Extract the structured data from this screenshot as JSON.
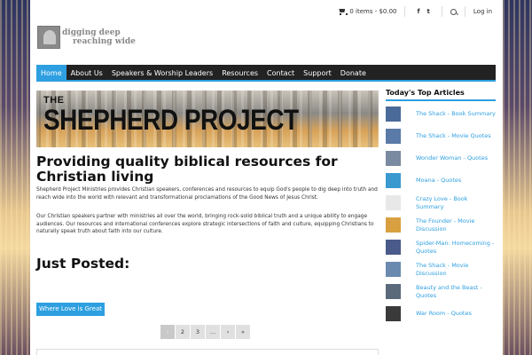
{
  "topbar": {
    "cart_text": "0 items - $0.00",
    "facebook": "f",
    "twitter": "t",
    "login": "Log in"
  },
  "logo": {
    "line1": "digging deep",
    "line2": "reaching wide"
  },
  "nav": {
    "items": [
      {
        "label": "Home",
        "active": true
      },
      {
        "label": "About Us"
      },
      {
        "label": "Speakers & Worship Leaders"
      },
      {
        "label": "Resources"
      },
      {
        "label": "Contact"
      },
      {
        "label": "Support"
      },
      {
        "label": "Donate"
      }
    ]
  },
  "hero": {
    "the": "THE",
    "title": "SHEPHERD PROJECT"
  },
  "main": {
    "headline": "Providing quality biblical resources for Christian living",
    "para1": "Shepherd Project Ministries provides Christian speakers, conferences and resources to equip God's people to dig deep into truth and reach wide into the world with relevant and transformational proclamations of the Good News of Jesus Christ.",
    "para2": "Our Christian speakers partner with ministries all over the world, bringing rock-solid biblical truth and a unique ability to engage audiences. Our resources and international conferences explore strategic intersections of faith and culture, equipping Christians to naturally speak truth about faith into our culture.",
    "just_posted": "Just Posted:",
    "post_button": "Where Love is Great",
    "pager": [
      "‹",
      "2",
      "3",
      "…",
      "›",
      "»"
    ]
  },
  "sidebar": {
    "title": "Today's Top Articles",
    "items": [
      {
        "label": "The Shack - Book Summary",
        "thumb": "#4a6a9a"
      },
      {
        "label": "The Shack - Movie Quotes",
        "thumb": "#5a7aa8"
      },
      {
        "label": "Wonder Woman - Quotes",
        "thumb": "#7a8aa0"
      },
      {
        "label": "Moana - Quotes",
        "thumb": "#3a9ad0"
      },
      {
        "label": "Crazy Love - Book Summary",
        "thumb": "#e8e8e8"
      },
      {
        "label": "The Founder - Movie Discussion",
        "thumb": "#d8a040"
      },
      {
        "label": "Spider-Man: Homecoming - Quotes",
        "thumb": "#4a5a8a"
      },
      {
        "label": "The Shack - Movie Discussion",
        "thumb": "#6a8ab0"
      },
      {
        "label": "Beauty and the Beast - Quotes",
        "thumb": "#5a6a7a"
      },
      {
        "label": "War Room - Quotes",
        "thumb": "#3a3a3a"
      }
    ]
  }
}
